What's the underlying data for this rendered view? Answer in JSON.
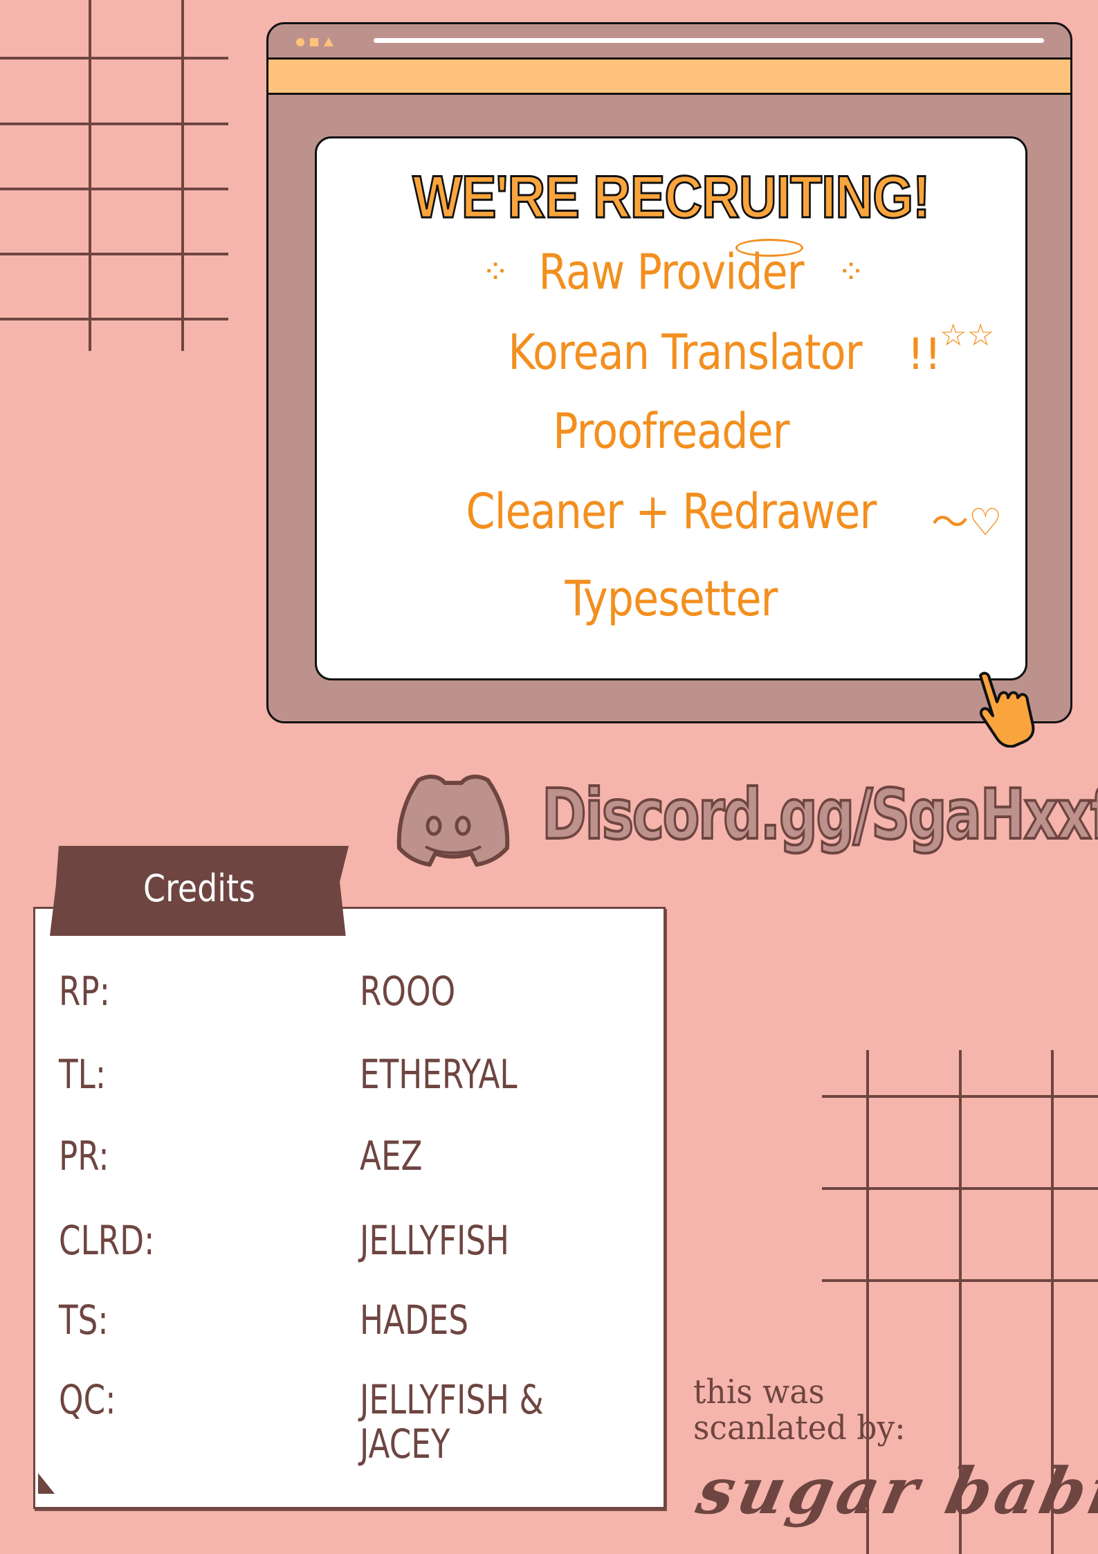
{
  "colors": {
    "background": "#f5b4ac",
    "grid_line": "#6e4540",
    "window_body": "#bd918c",
    "window_bar": "#ffc27a",
    "headline": "#f9a43c",
    "role_text": "#f28f1e",
    "credits_brown": "#6e4540"
  },
  "recruiting": {
    "headline": "WE'RE RECRUITING!",
    "roles": [
      {
        "label": "Raw Provider"
      },
      {
        "label": "Korean Translator"
      },
      {
        "label": "Proofreader"
      },
      {
        "label": "Cleaner + Redrawer"
      },
      {
        "label": "Typesetter"
      }
    ],
    "decorations": {
      "sparkle_left": "⁘",
      "sparkle_right": "⁘",
      "exclaim": "!!",
      "stars": "☆☆",
      "squiggle_heart": "〜♡"
    }
  },
  "discord": {
    "icon": "discord-icon",
    "link_text": "Discord.gg/SgaHxxf"
  },
  "credits": {
    "title": "Credits",
    "rows": [
      {
        "role": "RP:",
        "name": "ROOO"
      },
      {
        "role": "TL:",
        "name": "ETHERYAL"
      },
      {
        "role": "PR:",
        "name": "AEZ"
      },
      {
        "role": "CLRD:",
        "name": "JELLYFISH"
      },
      {
        "role": "TS:",
        "name": "HADES"
      },
      {
        "role": "QC:",
        "name": "JELLYFISH &\nJACEY"
      }
    ]
  },
  "footer": {
    "scanlated_by_line1": "this was",
    "scanlated_by_line2": "scanlated by:",
    "group_name": "sugar babies"
  }
}
